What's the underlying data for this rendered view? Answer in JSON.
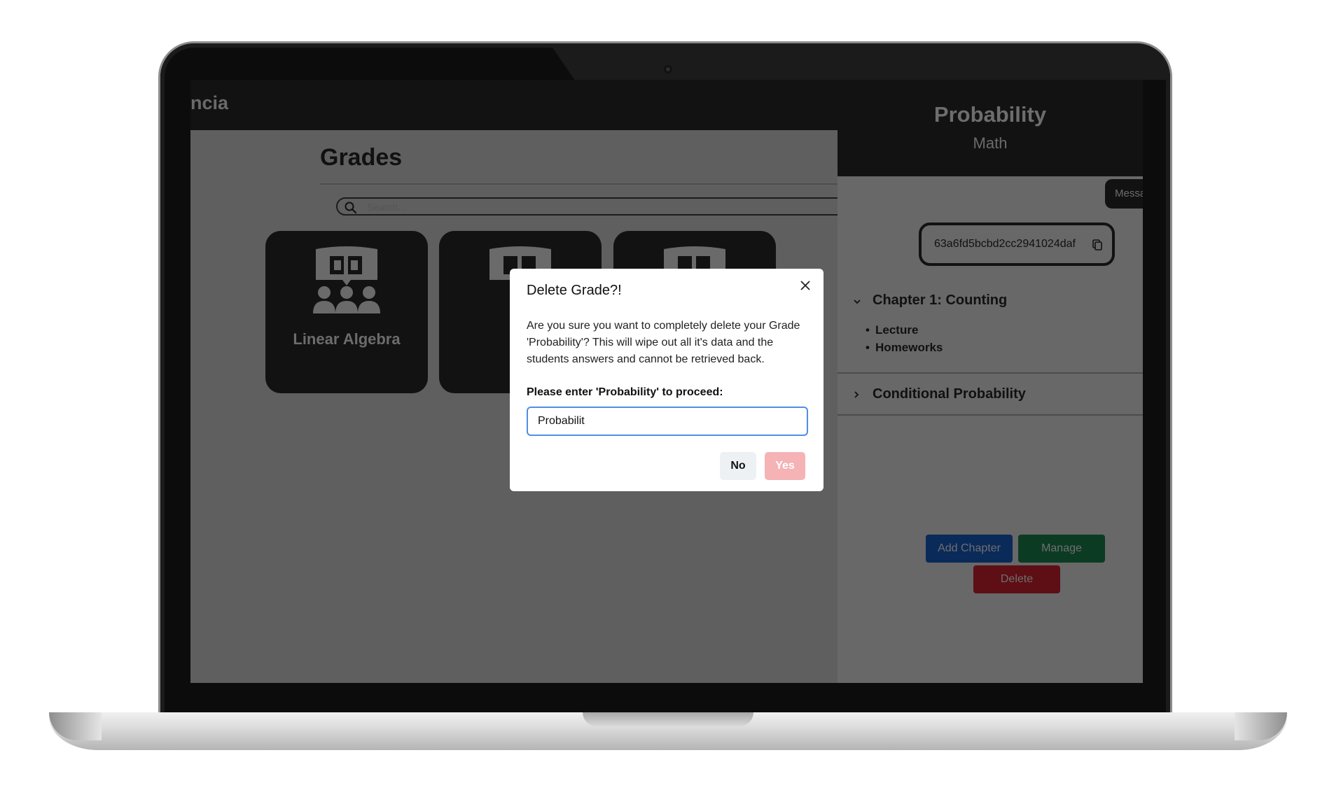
{
  "app": {
    "brand_fragment": "ncia"
  },
  "page": {
    "title": "Grades",
    "search_placeholder": "Search...",
    "cards": [
      {
        "label": "Linear Algebra",
        "icon": "classroom-icon"
      },
      {
        "label": "",
        "icon": "classroom-icon"
      },
      {
        "label": "",
        "icon": "classroom-icon"
      }
    ]
  },
  "panel": {
    "title": "Probability",
    "subtitle": "Math",
    "message_button": "Messa",
    "grade_id": "63a6fd5bcbd2cc2941024daf",
    "chapters": [
      {
        "title": "Chapter 1: Counting",
        "expanded": true,
        "lessons": [
          "Lecture",
          "Homeworks"
        ]
      },
      {
        "title": "Conditional Probability",
        "expanded": false,
        "lessons": []
      }
    ],
    "buttons": {
      "add_chapter": "Add Chapter",
      "manage": "Manage",
      "delete": "Delete"
    }
  },
  "modal": {
    "title": "Delete Grade?!",
    "body": "Are you sure you want to completely delete your Grade 'Probability'? This will wipe out all it's data and the students answers and cannot be retrieved back.",
    "prompt": "Please enter 'Probability' to proceed:",
    "input_value": "Probabilit",
    "no_label": "No",
    "yes_label": "Yes"
  },
  "colors": {
    "overlay": "#5f5f5f",
    "focus_border": "#4f8fe3",
    "yes_disabled": "#f5b3b6",
    "add_chapter": "#0a2a59",
    "manage": "#0c3b24",
    "delete": "#5d0f15"
  }
}
